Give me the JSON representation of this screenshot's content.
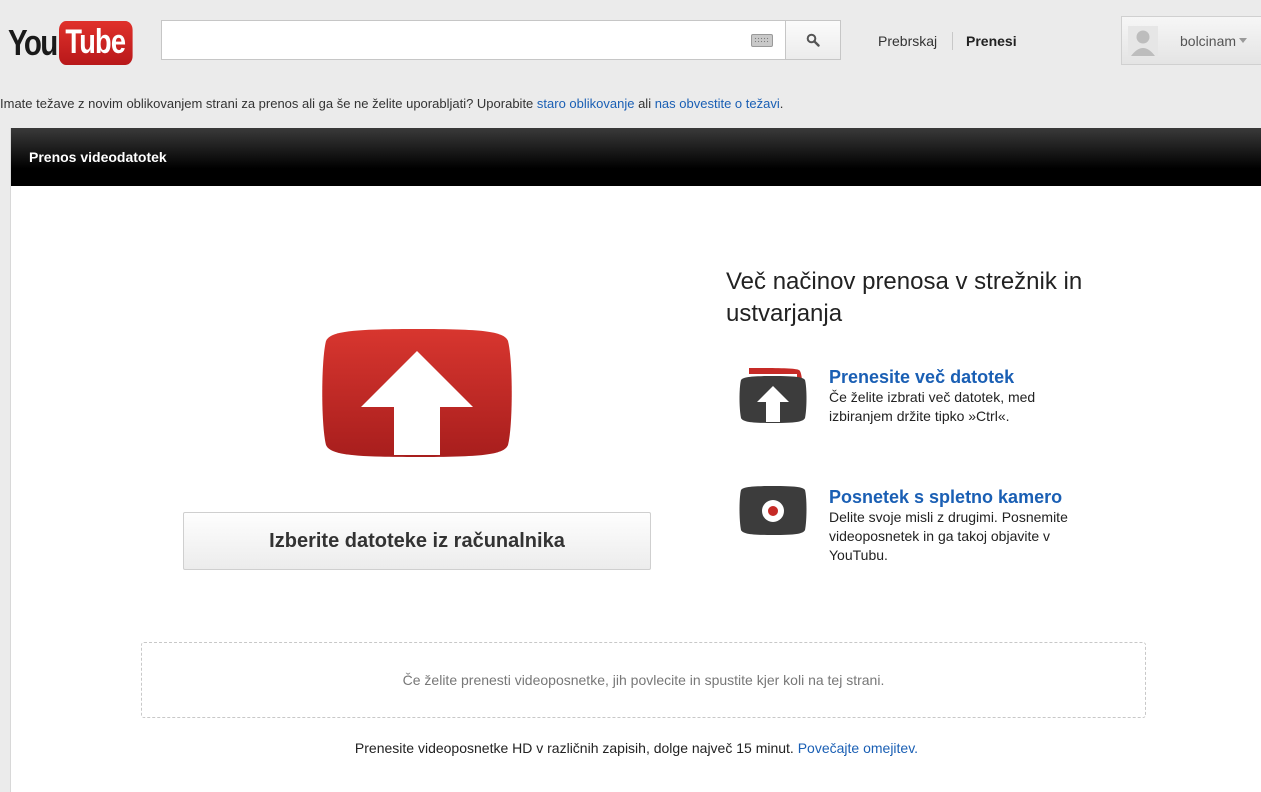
{
  "masthead": {
    "logo": {
      "part1": "You",
      "part2": "Tube"
    },
    "search": {
      "value": "",
      "placeholder": ""
    },
    "nav": {
      "browse": "Prebrskaj",
      "upload": "Prenesi"
    },
    "user": {
      "name": "bolcinam"
    }
  },
  "notice": {
    "text": "Imate težave z novim oblikovanjem strani za prenos ali ga še ne želite uporabljati? Uporabite ",
    "link_old": "staro oblikovanje",
    "middle": " ali ",
    "link_report": "nas obvestite o težavi",
    "end": "."
  },
  "panel": {
    "title": "Prenos videodatotek",
    "select_button": "Izberite datoteke iz računalnika",
    "side_heading": "Več načinov prenosa v strežnik in ustvarjanja",
    "options": [
      {
        "title": "Prenesite več datotek",
        "desc": "Če želite izbrati več datotek, med izbiranjem držite tipko »Ctrl«."
      },
      {
        "title": "Posnetek s spletno kamero",
        "desc": "Delite svoje misli z drugimi. Posnemite videoposnetek in ga takoj objavite v YouTubu."
      }
    ],
    "drop_hint": "Če želite prenesti videoposnetke, jih povlecite in spustite kjer koli na tej strani.",
    "footer_text": "Prenesite videoposnetke HD v različnih zapisih, dolge največ 15 minut. ",
    "footer_link": "Povečajte omejitev."
  },
  "colors": {
    "brand_red": "#cc2a24",
    "link_blue": "#1a5fb4",
    "header_black": "#000000"
  }
}
